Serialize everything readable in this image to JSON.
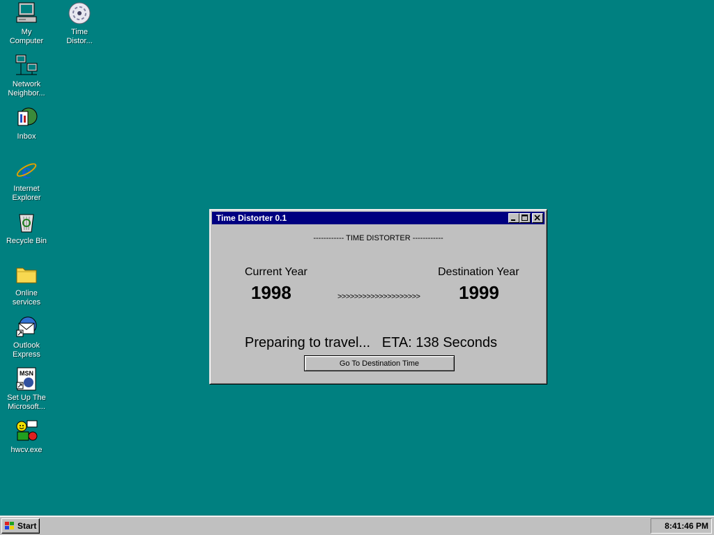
{
  "desktop": {
    "icons": [
      {
        "label": "My\nComputer"
      },
      {
        "label": "Time\nDistor..."
      },
      {
        "label": "Network\nNeighbor..."
      },
      {
        "label": "Inbox"
      },
      {
        "label": "Internet\nExplorer"
      },
      {
        "label": "Recycle Bin"
      },
      {
        "label": "Online\nservices"
      },
      {
        "label": "Outlook\nExpress"
      },
      {
        "label": "Set Up The\nMicrosoft..."
      },
      {
        "label": "hwcv.exe"
      }
    ]
  },
  "window": {
    "title": "Time Distorter 0.1",
    "heading": "------------  TIME DISTORTER  ------------",
    "current_year_label": "Current Year",
    "current_year_value": "1998",
    "destination_year_label": "Destination Year",
    "destination_year_value": "1999",
    "arrows": ">>>>>>>>>>>>>>>>>>>>",
    "status_text": "Preparing to travel...",
    "eta_text": "ETA: 138 Seconds",
    "go_button_label": "Go To Destination Time"
  },
  "taskbar": {
    "start_label": "Start",
    "clock": "8:41:46 PM"
  },
  "colors": {
    "desktop": "#008080",
    "titlebar": "#000080",
    "face": "#c0c0c0"
  }
}
